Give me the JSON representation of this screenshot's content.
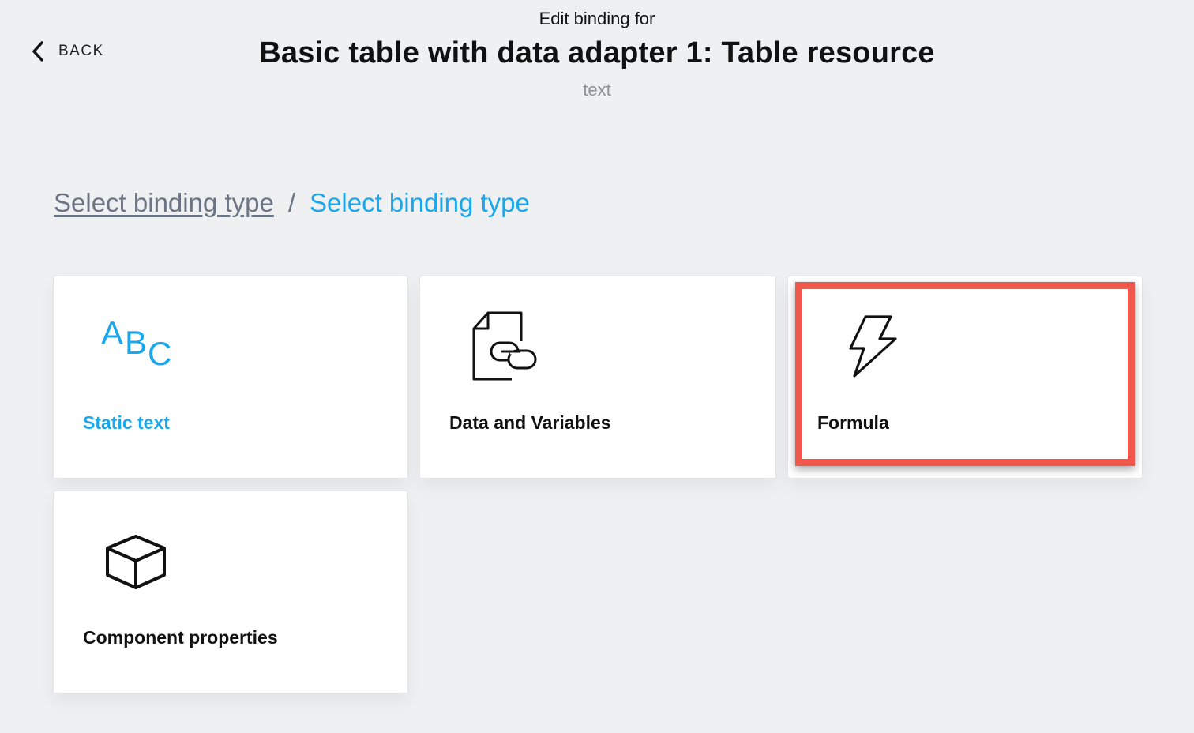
{
  "nav": {
    "back_label": "BACK",
    "back_icon": "chevron-left-icon"
  },
  "header": {
    "eyebrow": "Edit binding for",
    "title": "Basic table with data adapter 1: Table resource",
    "subtitle": "text"
  },
  "breadcrumb": {
    "parent": "Select binding type",
    "separator": "/",
    "current": "Select binding type"
  },
  "binding_types": [
    {
      "label": "Static text",
      "icon": "abc-text-icon",
      "selected": false,
      "accent": true
    },
    {
      "label": "Data and Variables",
      "icon": "linked-document-icon",
      "selected": false,
      "accent": false
    },
    {
      "label": "Formula",
      "icon": "lightning-bolt-icon",
      "selected": true,
      "accent": false
    },
    {
      "label": "Component properties",
      "icon": "cube-icon",
      "selected": false,
      "accent": false
    }
  ],
  "abc_icon_letters": [
    "A",
    "B",
    "C"
  ],
  "colors": {
    "accent": "#1aa7ec",
    "highlight": "#f2574b",
    "background": "#eff0f2"
  }
}
